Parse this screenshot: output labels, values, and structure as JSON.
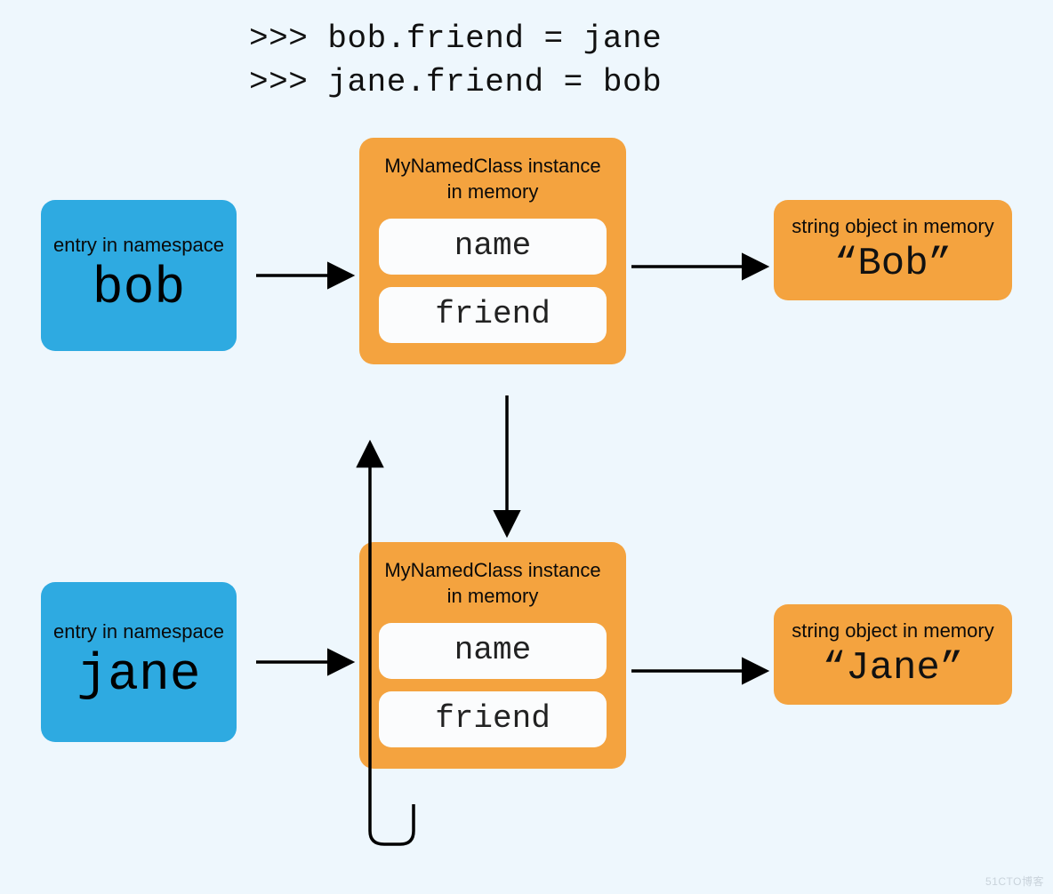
{
  "code": {
    "line1": ">>> bob.friend = jane",
    "line2": ">>> jane.friend = bob"
  },
  "namespace": {
    "label": "entry in namespace",
    "bob": "bob",
    "jane": "jane"
  },
  "instance": {
    "label": "MyNamedClass instance in memory",
    "attr1": "name",
    "attr2": "friend"
  },
  "string_obj": {
    "label": "string object in memory",
    "bob_val": "“Bob”",
    "jane_val": "“Jane”"
  },
  "watermark": "51CTO博客"
}
